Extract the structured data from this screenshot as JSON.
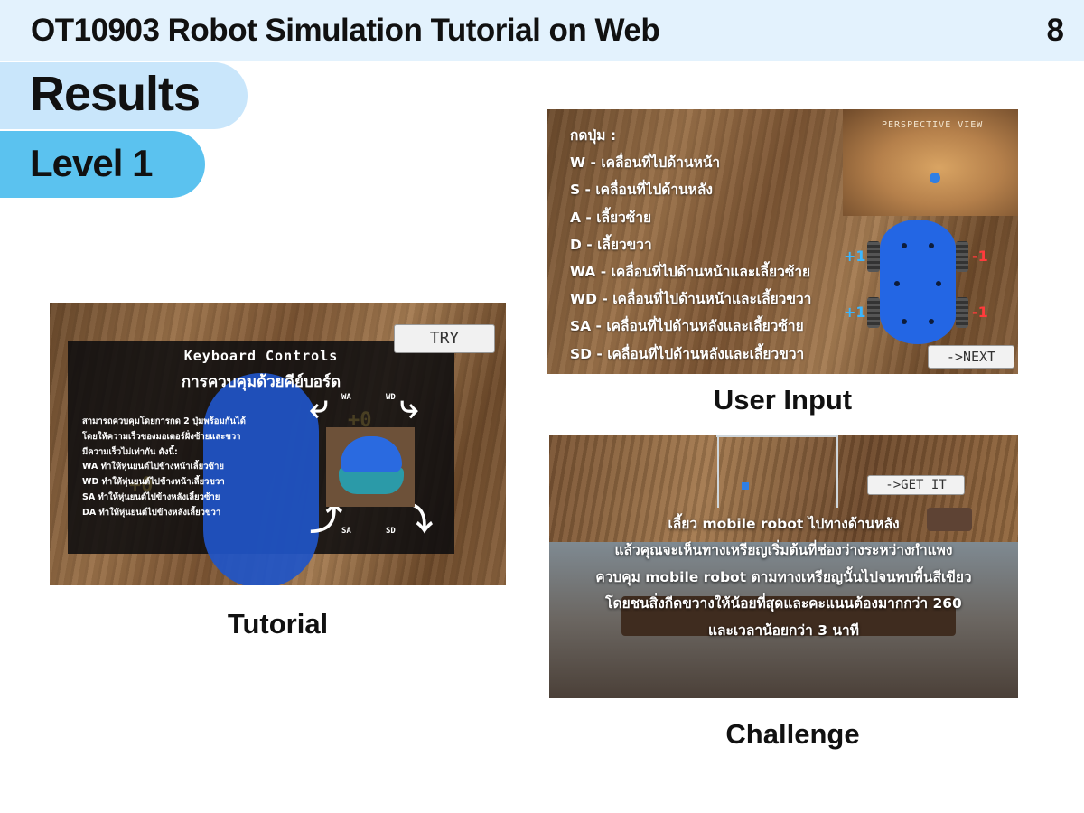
{
  "header": {
    "title": "OT10903 Robot Simulation Tutorial on Web",
    "page_number": "8"
  },
  "section": {
    "title": "Results",
    "level": "Level 1"
  },
  "tutorial": {
    "caption": "Tutorial",
    "try_label": "TRY",
    "heading_en": "Keyboard Controls",
    "heading_th": "การควบคุมด้วยคีย์บอร์ด",
    "lines": [
      "สามารถควบคุมโดยการกด 2 ปุ่มพร้อมกันได้",
      "โดยให้ความเร็วของมอเตอร์ฝั่งซ้ายและขวา",
      "มีความเร็วไม่เท่ากัน ดังนี้:",
      "WA ทำให้หุ่นยนต์ไปข้างหน้าเลี้ยวซ้าย",
      "WD ทำให้หุ่นยนต์ไปข้างหน้าเลี้ยวขวา",
      "SA ทำให้หุ่นยนต์ไปข้างหลังเลี้ยวซ้าย",
      "DA ทำให้หุ่นยนต์ไปข้างหลังเลี้ยวขวา"
    ],
    "key_labels": {
      "wa": "WA",
      "wd": "WD",
      "sa": "SA",
      "sd": "SD"
    }
  },
  "user_input": {
    "caption": "User Input",
    "perspective_label": "PERSPECTIVE VIEW",
    "next_label": "->NEXT",
    "lines": [
      "กดปุ่ม :",
      "W - เคลื่อนที่ไปด้านหน้า",
      "S - เคลื่อนที่ไปด้านหลัง",
      "A - เลี้ยวซ้าย",
      "D - เลี้ยวขวา",
      "WA - เคลื่อนที่ไปด้านหน้าและเลี้ยวซ้าย",
      "WD - เคลื่อนที่ไปด้านหน้าและเลี้ยวขวา",
      "SA - เคลื่อนที่ไปด้านหลังและเลี้ยวซ้าย",
      "SD - เคลื่อนที่ไปด้านหลังและเลี้ยวขวา"
    ],
    "motor_values": {
      "left_top": "+1",
      "left_bottom": "+1",
      "right_top": "-1",
      "right_bottom": "-1"
    }
  },
  "challenge": {
    "caption": "Challenge",
    "get_it_label": "->GET IT",
    "lines": [
      "เลี้ยว mobile robot ไปทางด้านหลัง",
      "แล้วคุณจะเห็นทางเหรียญเริ่มต้นที่ช่องว่างระหว่างกำแพง",
      "ควบคุม mobile robot ตามทางเหรียญนั้นไปจนพบพื้นสีเขียว",
      "โดยชนสิ่งกีดขวางให้น้อยที่สุดและคะแนนต้องมากกว่า 260",
      "และเวลาน้อยกว่า 3 นาที"
    ]
  },
  "colors": {
    "header_bg": "#e3f2fd",
    "results_pill": "#c9e6fb",
    "level_pill": "#5bc2ef",
    "robot_blue": "#2366e4"
  }
}
